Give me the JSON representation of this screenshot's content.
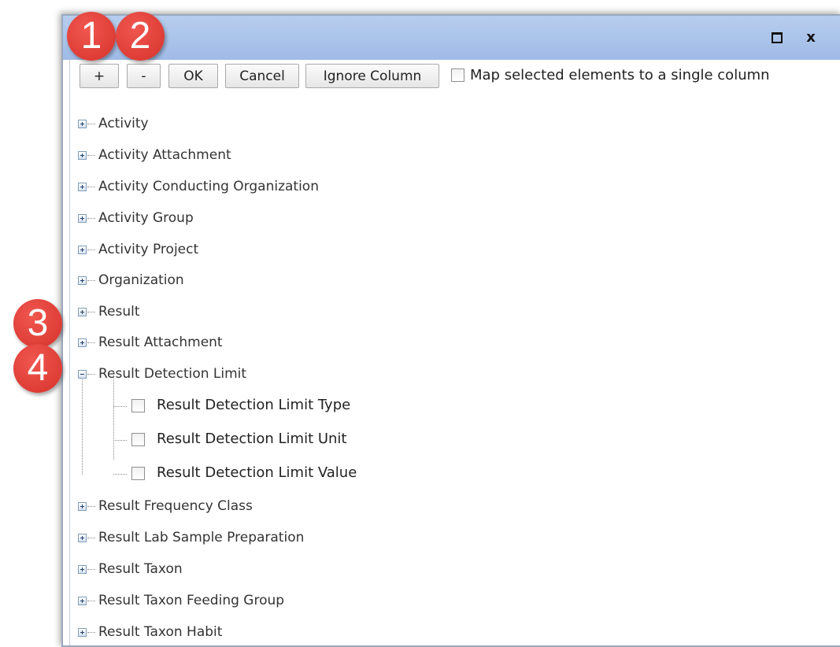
{
  "window": {
    "maximize_icon": "maximize-icon",
    "close_label": "x"
  },
  "toolbar": {
    "expand_label": "+",
    "collapse_label": "-",
    "ok_label": "OK",
    "cancel_label": "Cancel",
    "ignore_column_label": "Ignore Column",
    "map_single_column_label": "Map selected elements to a single column",
    "map_single_column_checked": false
  },
  "tree": {
    "nodes": [
      {
        "label": "Activity",
        "expanded": false
      },
      {
        "label": "Activity Attachment",
        "expanded": false
      },
      {
        "label": "Activity Conducting Organization",
        "expanded": false
      },
      {
        "label": "Activity Group",
        "expanded": false
      },
      {
        "label": "Activity Project",
        "expanded": false
      },
      {
        "label": "Organization",
        "expanded": false
      },
      {
        "label": "Result",
        "expanded": false
      },
      {
        "label": "Result Attachment",
        "expanded": false
      },
      {
        "label": "Result Detection Limit",
        "expanded": true,
        "children": [
          {
            "label": "Result Detection Limit Type",
            "checked": false
          },
          {
            "label": "Result Detection Limit Unit",
            "checked": false
          },
          {
            "label": "Result Detection Limit Value",
            "checked": false
          }
        ]
      },
      {
        "label": "Result Frequency Class",
        "expanded": false
      },
      {
        "label": "Result Lab Sample Preparation",
        "expanded": false
      },
      {
        "label": "Result Taxon",
        "expanded": false
      },
      {
        "label": "Result Taxon Feeding Group",
        "expanded": false
      },
      {
        "label": "Result Taxon Habit",
        "expanded": false
      }
    ]
  },
  "callouts": [
    "1",
    "2",
    "3",
    "4"
  ],
  "colors": {
    "titlebar": "#a9c4ea",
    "callout_red": "#e0433c"
  }
}
